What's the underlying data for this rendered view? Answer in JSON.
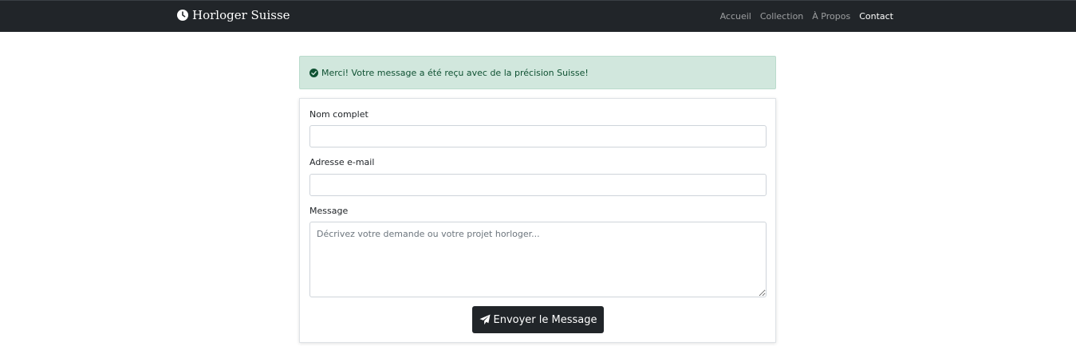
{
  "navbar": {
    "brand": "Horloger Suisse",
    "brand_icon": "clock-icon",
    "links": [
      {
        "label": "Accueil",
        "active": false
      },
      {
        "label": "Collection",
        "active": false
      },
      {
        "label": "À Propos",
        "active": false
      },
      {
        "label": "Contact",
        "active": true
      }
    ]
  },
  "alert": {
    "icon": "check-circle-icon",
    "message": "Merci! Votre message a été reçu avec de la précision Suisse!"
  },
  "form": {
    "name_label": "Nom complet",
    "name_value": "",
    "email_label": "Adresse e-mail",
    "email_value": "",
    "message_label": "Message",
    "message_placeholder": "Décrivez votre demande ou votre projet horloger...",
    "submit_label": "Envoyer le Message",
    "submit_icon": "paper-plane-icon"
  },
  "colors": {
    "navbar_bg": "#212529",
    "alert_bg": "#d1e7dd",
    "alert_text": "#0f5132",
    "button_bg": "#212529"
  }
}
